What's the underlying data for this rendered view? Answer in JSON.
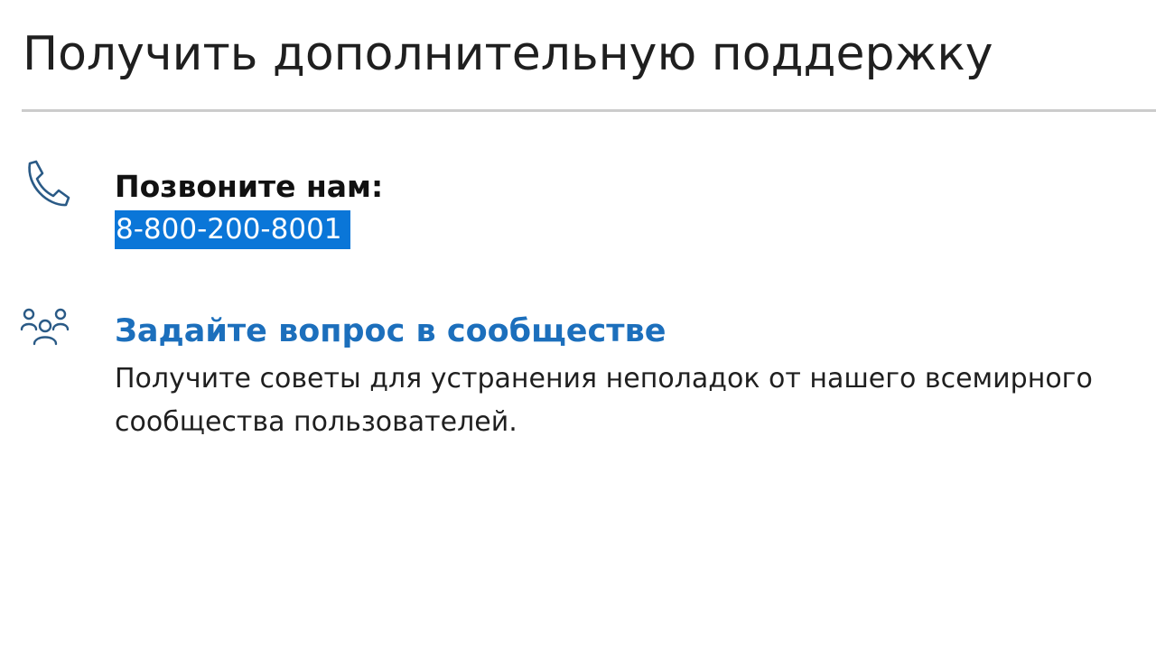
{
  "page": {
    "title": "Получить дополнительную поддержку"
  },
  "call": {
    "icon": "phone-icon",
    "heading": "Позвоните нам:",
    "number": "8-800-200-8001"
  },
  "community": {
    "icon": "people-icon",
    "link_label": "Задайте вопрос в сообществе",
    "description": "Получите советы для устранения неполадок от нашего всемирного сообщества пользователей."
  },
  "colors": {
    "link": "#1c6fbc",
    "selection": "#0a76d8",
    "icon": "#2a5a86",
    "divider": "#cccccc"
  }
}
